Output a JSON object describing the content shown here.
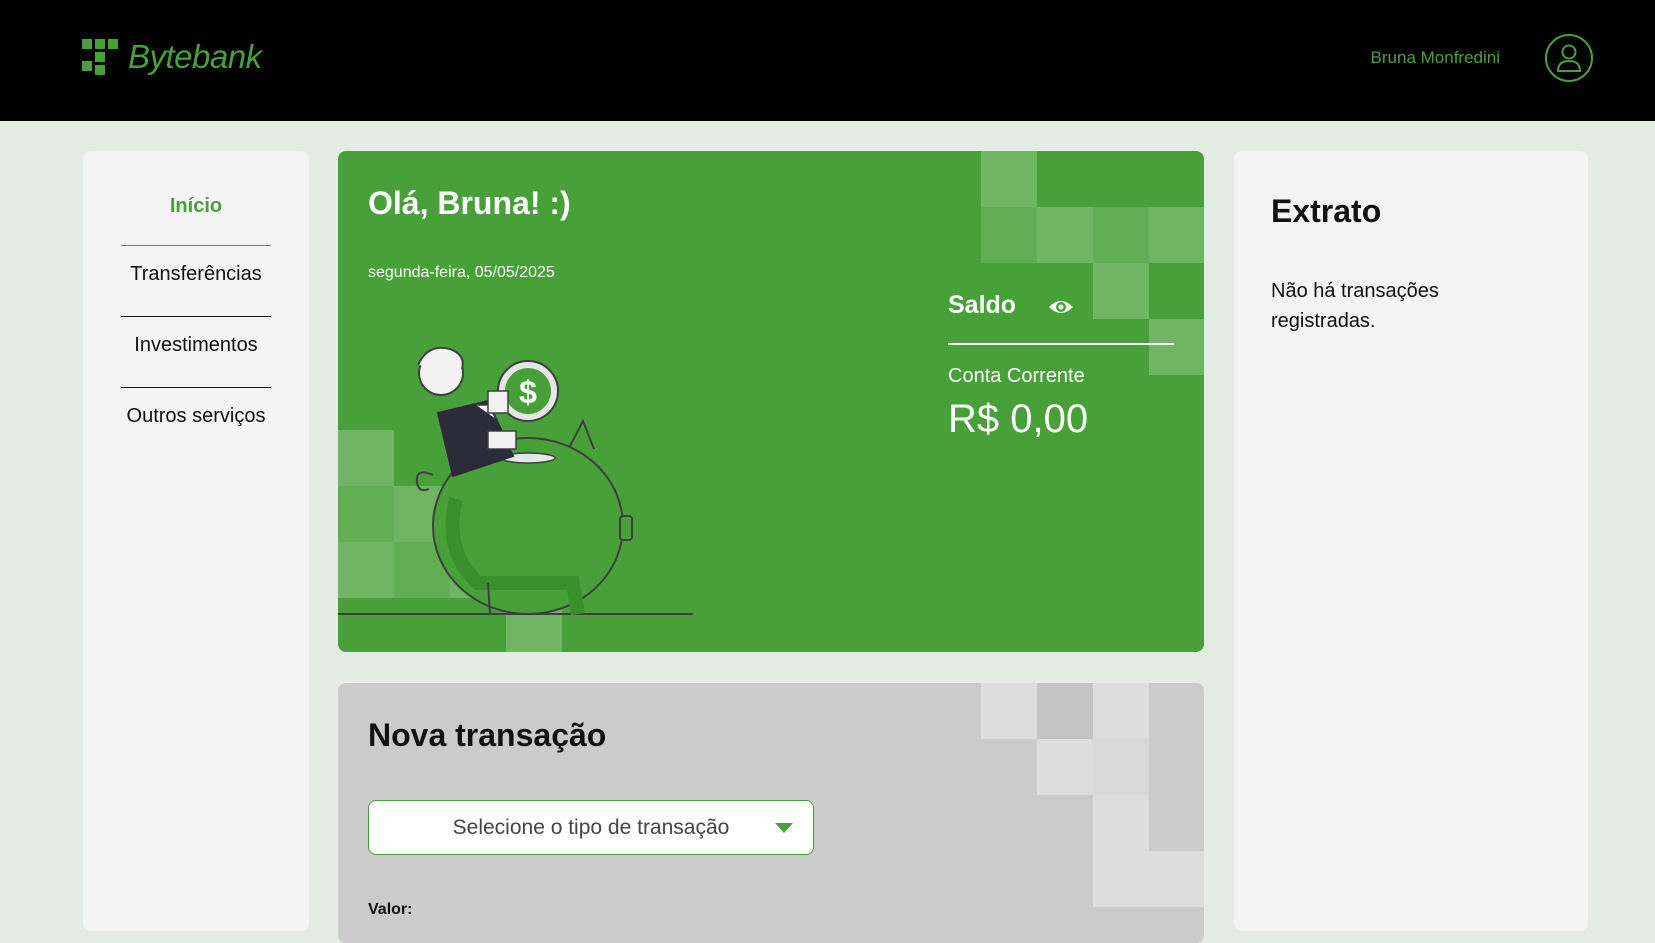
{
  "header": {
    "logo_text": "Bytebank",
    "user_name": "Bruna Monfredini",
    "avatar_icon": "user-icon"
  },
  "sidebar": {
    "items": [
      {
        "label": "Início",
        "active": true
      },
      {
        "label": "Transferências",
        "active": false
      },
      {
        "label": "Investimentos",
        "active": false
      },
      {
        "label": "Outros serviços",
        "active": false
      }
    ]
  },
  "welcome": {
    "greeting": "Olá, Bruna! :)",
    "date": "segunda-feira, 05/05/2025",
    "balance_label": "Saldo",
    "balance_icon": "eye-icon",
    "account_label": "Conta Corrente",
    "balance_value": "R$ 0,00"
  },
  "new_transaction": {
    "title": "Nova transação",
    "select_placeholder": "Selecione o tipo de transação",
    "amount_label": "Valor:"
  },
  "statement": {
    "title": "Extrato",
    "empty_message": "Não há transações registradas."
  },
  "colors": {
    "brand_green": "#47a138",
    "header_bg": "#000000",
    "page_bg": "#e4ede3",
    "card_bg": "#f4f4f4",
    "form_bg": "#cbcbcb"
  }
}
